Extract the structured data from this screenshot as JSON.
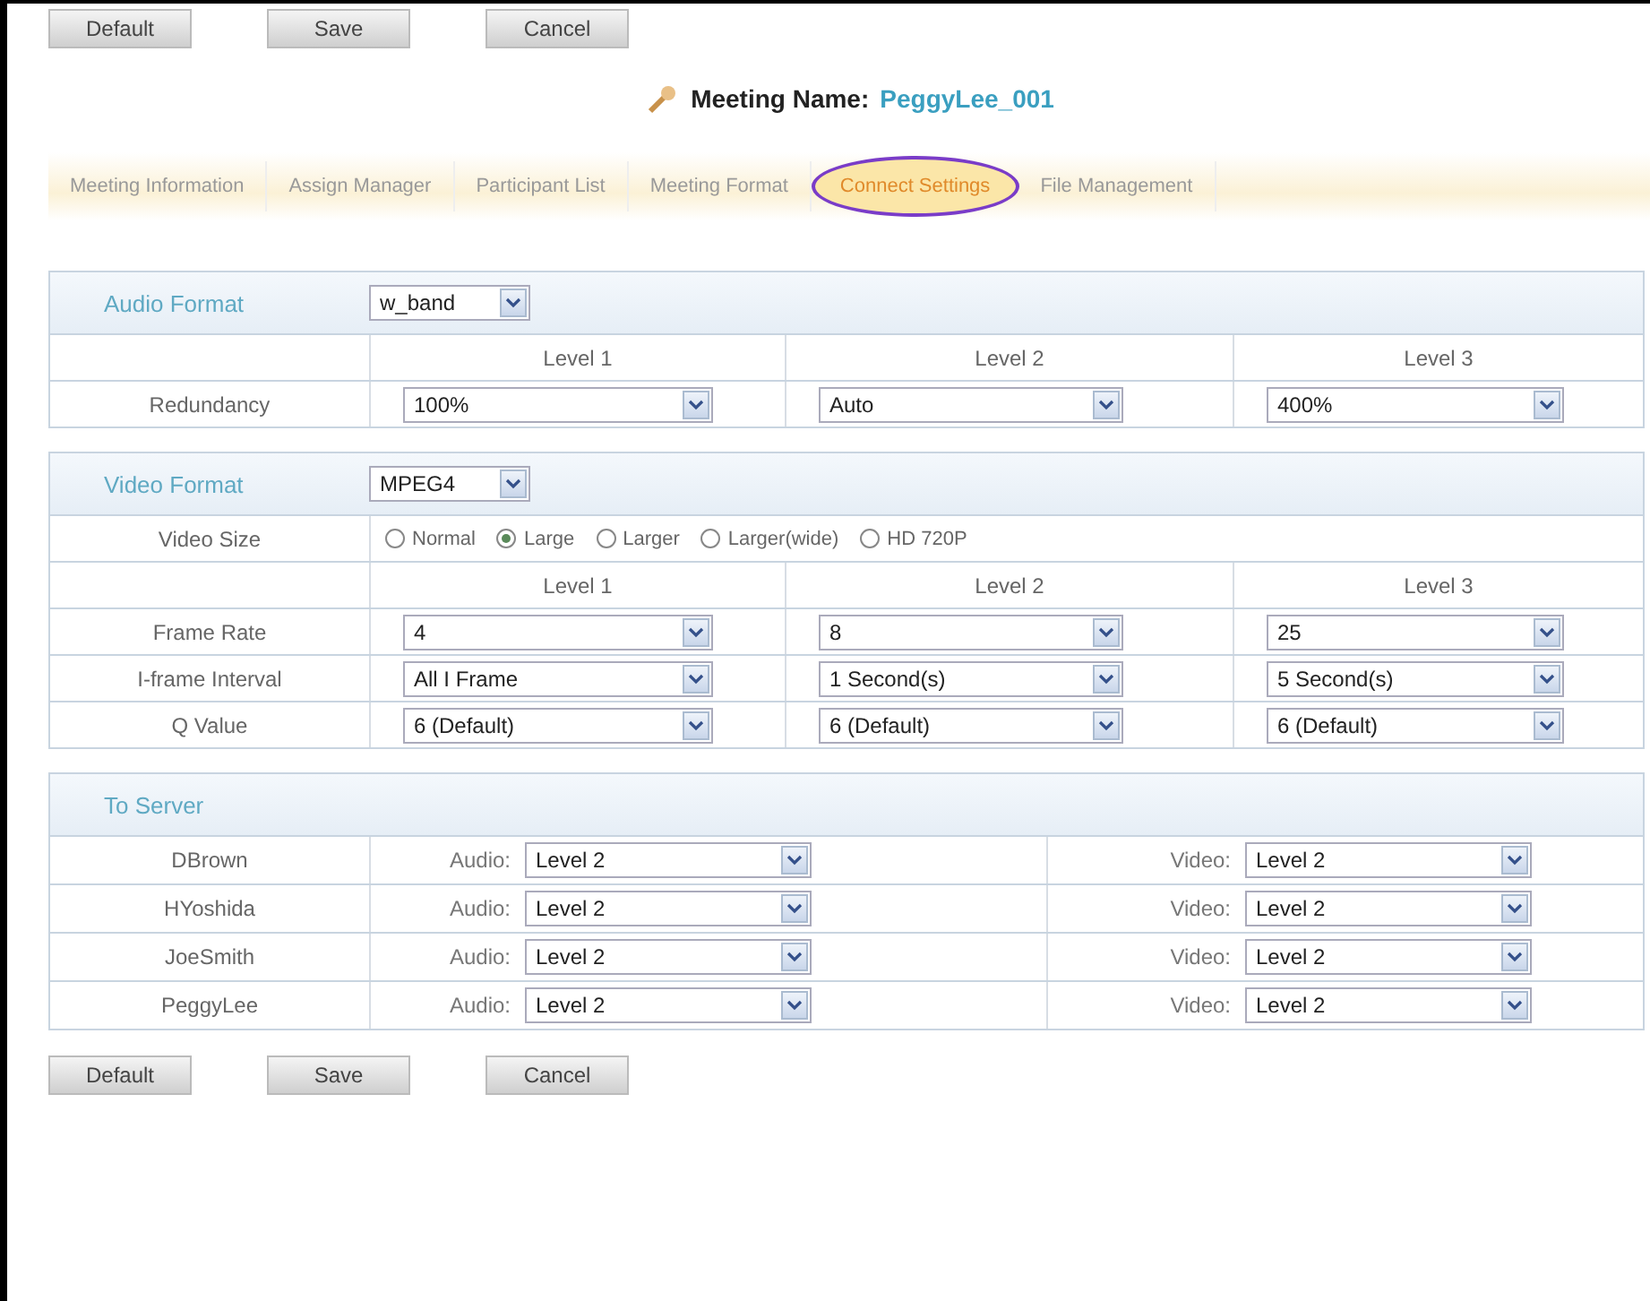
{
  "top_buttons": [
    "Default",
    "Save",
    "Cancel"
  ],
  "meeting": {
    "label": "Meeting Name:",
    "value": "PeggyLee_001"
  },
  "tabs": [
    {
      "label": "Meeting Information",
      "selected": false
    },
    {
      "label": "Assign Manager",
      "selected": false
    },
    {
      "label": "Participant List",
      "selected": false
    },
    {
      "label": "Meeting Format",
      "selected": false
    },
    {
      "label": "Connect Settings",
      "selected": true
    },
    {
      "label": "File Management",
      "selected": false
    }
  ],
  "audio": {
    "label": "Audio Format",
    "value": "w_band",
    "levels": [
      "Level 1",
      "Level 2",
      "Level 3"
    ],
    "rows": [
      {
        "label": "Redundancy",
        "values": [
          "100%",
          "Auto",
          "400%"
        ]
      }
    ]
  },
  "video": {
    "label": "Video Format",
    "value": "MPEG4",
    "size_label": "Video Size",
    "sizes": [
      {
        "label": "Normal",
        "selected": false
      },
      {
        "label": "Large",
        "selected": true
      },
      {
        "label": "Larger",
        "selected": false
      },
      {
        "label": "Larger(wide)",
        "selected": false
      },
      {
        "label": "HD 720P",
        "selected": false
      }
    ],
    "levels": [
      "Level 1",
      "Level 2",
      "Level 3"
    ],
    "rows": [
      {
        "label": "Frame Rate",
        "values": [
          "4",
          "8",
          "25"
        ]
      },
      {
        "label": "I-frame Interval",
        "values": [
          "All I Frame",
          "1 Second(s)",
          "5 Second(s)"
        ]
      },
      {
        "label": "Q Value",
        "values": [
          "6 (Default)",
          "6 (Default)",
          "6 (Default)"
        ]
      }
    ]
  },
  "to_server": {
    "title": "To Server",
    "rows": [
      {
        "name": "DBrown",
        "audio_label": "Audio:",
        "audio": "Level 2",
        "video_label": "Video:",
        "video": "Level 2"
      },
      {
        "name": "HYoshida",
        "audio_label": "Audio:",
        "audio": "Level 2",
        "video_label": "Video:",
        "video": "Level 2"
      },
      {
        "name": "JoeSmith",
        "audio_label": "Audio:",
        "audio": "Level 2",
        "video_label": "Video:",
        "video": "Level 2"
      },
      {
        "name": "PeggyLee",
        "audio_label": "Audio:",
        "audio": "Level 2",
        "video_label": "Video:",
        "video": "Level 2"
      }
    ]
  },
  "bottom_buttons": [
    "Default",
    "Save",
    "Cancel"
  ]
}
